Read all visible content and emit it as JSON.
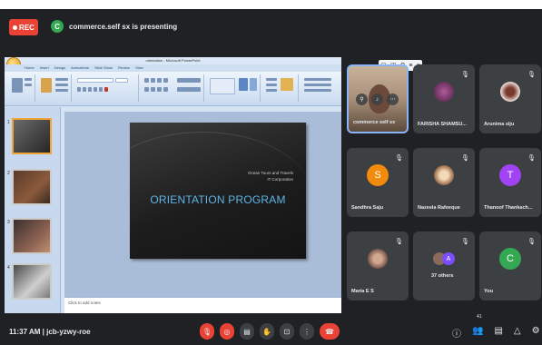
{
  "topbar": {
    "rec_label": "REC",
    "presenter_initial": "C",
    "presenter_text": "commerce.self sx is presenting"
  },
  "presentation": {
    "window_title": "orientation - Microsoft PowerPoint",
    "ribbon_tabs": [
      "Home",
      "Insert",
      "Design",
      "Animations",
      "Slide Show",
      "Review",
      "View"
    ],
    "slide_subtitle_line1": "Ocean Tours and Travels",
    "slide_subtitle_line2": "IT Corporation",
    "slide_title": "ORIENTATION PROGRAM",
    "notes_placeholder": "Click to add notes",
    "thumbnail_numbers": [
      "1",
      "2",
      "3",
      "4"
    ]
  },
  "participants": [
    {
      "name": "commerce self sx",
      "kind": "video"
    },
    {
      "name": "FARISHA SHAMSU...",
      "kind": "photo",
      "color": "#8a3f7a"
    },
    {
      "name": "Arunima siju",
      "kind": "photo",
      "color": "#e8d8d0"
    },
    {
      "name": "Sandhra Saju",
      "kind": "initial",
      "initial": "S",
      "color": "#f28b0c"
    },
    {
      "name": "Nazeela Rafeeque",
      "kind": "photo",
      "color": "#c49a6c"
    },
    {
      "name": "Thanoof Thankach...",
      "kind": "initial",
      "initial": "T",
      "color": "#a142f4"
    },
    {
      "name": "Maria E S",
      "kind": "photo",
      "color": "#9a7060"
    },
    {
      "name": "37 others",
      "kind": "group",
      "initial": "A",
      "color": "#7c4dff"
    },
    {
      "name": "You",
      "kind": "initial",
      "initial": "C",
      "color": "#34a853"
    }
  ],
  "bottombar": {
    "time": "11:37 AM",
    "separator": "|",
    "meeting_code": "jcb-yzwy-roe",
    "participant_count": "41"
  },
  "colors": {
    "background": "#202124",
    "tile": "#3c4043",
    "danger": "#ea4335"
  }
}
